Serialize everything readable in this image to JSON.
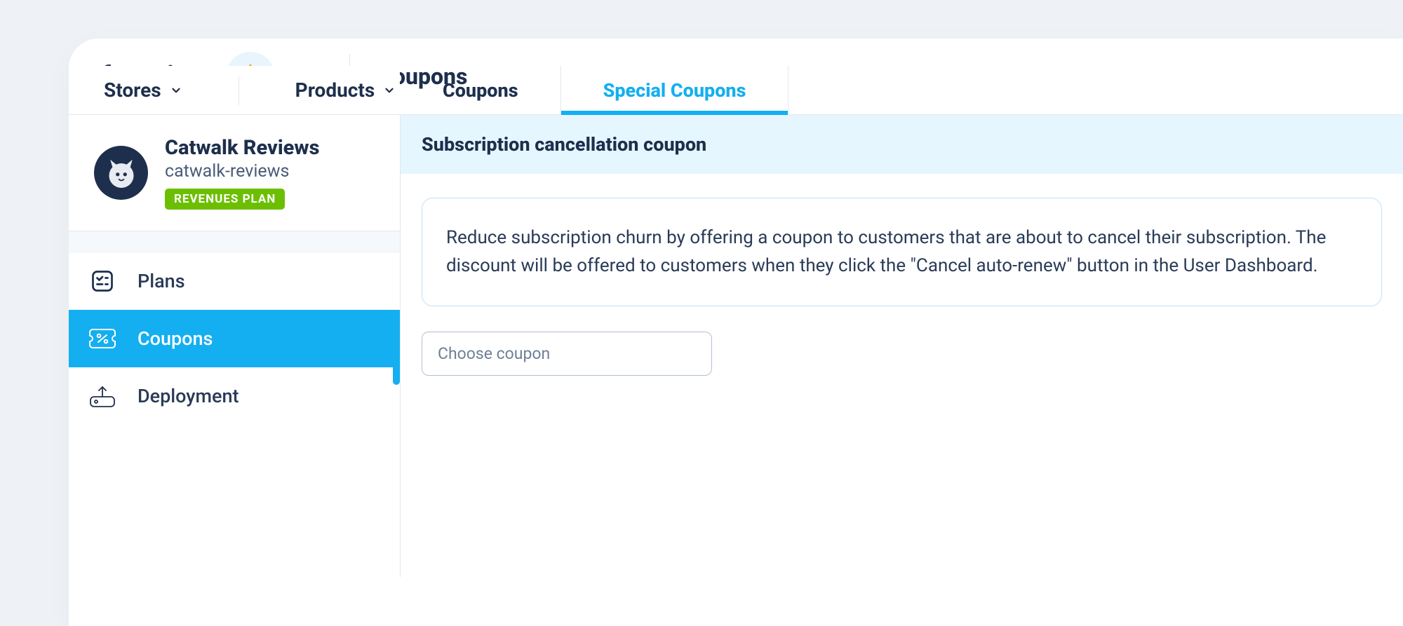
{
  "header": {
    "logo_text": "freemius",
    "page_title": "Coupons"
  },
  "secondary_nav": {
    "items": [
      {
        "label": "Stores"
      },
      {
        "label": "Products"
      }
    ]
  },
  "product": {
    "name": "Catwalk Reviews",
    "slug": "catwalk-reviews",
    "plan_badge": "REVENUES PLAN"
  },
  "sidebar": {
    "items": [
      {
        "label": "Plans",
        "icon": "checklist-icon",
        "active": false
      },
      {
        "label": "Coupons",
        "icon": "coupon-icon",
        "active": true
      },
      {
        "label": "Deployment",
        "icon": "upload-icon",
        "active": false
      }
    ]
  },
  "tabs": [
    {
      "label": "Coupons",
      "active": false
    },
    {
      "label": "Special Coupons",
      "active": true
    }
  ],
  "section": {
    "heading": "Subscription cancellation coupon",
    "info_text": "Reduce subscription churn by offering a coupon to customers that are about to cancel their subscription. The discount will be offered to customers when they click the \"Cancel auto-renew\" button in the User Dashboard.",
    "select_placeholder": "Choose coupon"
  }
}
